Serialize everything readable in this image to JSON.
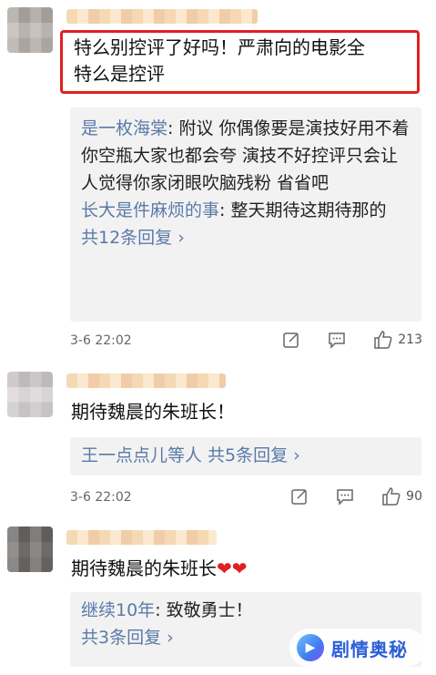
{
  "comments": [
    {
      "text_line1": "特么别控评了好吗！严肃向的电影全",
      "text_line2": "特么是控评",
      "replies": [
        {
          "user": "是一枚海棠",
          "text": ": 附议 你偶像要是演技好用不着你空瓶大家也都会夸 演技不好控评只会让人觉得你家闭眼吹脑残粉 省省吧"
        },
        {
          "user": "长大是件麻烦的事",
          "text": ": 整天期待这期待那的"
        }
      ],
      "more": "共12条回复 ›",
      "time": "3-6 22:02",
      "likes": "213"
    },
    {
      "text": "期待魏晨的朱班长！",
      "reply_summary_user": "王一点点儿等人",
      "reply_summary_more": " 共5条回复 ›",
      "time": "3-6 22:02",
      "likes": "90"
    },
    {
      "text": "期待魏晨的朱班长",
      "hearts": "❤❤",
      "replies": [
        {
          "user": "继续10年",
          "text": ": 致敬勇士！"
        }
      ],
      "more": "共3条回复 ›"
    }
  ],
  "watermark": {
    "text": "剧情奥秘"
  },
  "colors": {
    "highlight": "#e02020",
    "link": "#5a7aa8"
  }
}
